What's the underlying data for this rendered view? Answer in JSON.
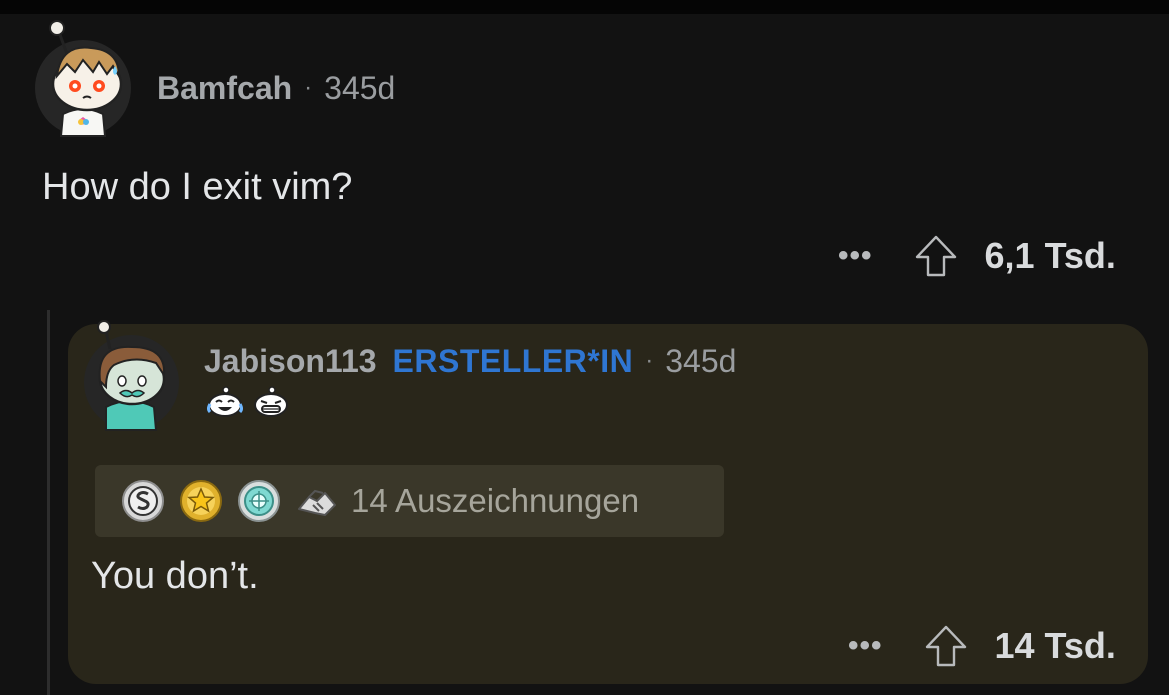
{
  "comment": {
    "author": "Bamfcah",
    "age": "345d",
    "body": "How do I exit vim?",
    "score": "6,1 Tsd.",
    "avatar_icon": "snoo-avatar-icon",
    "more_icon": "more-options-icon",
    "upvote_icon": "upvote-arrow-icon"
  },
  "reply": {
    "author": "Jabison113",
    "op_badge": "ERSTELLER*IN",
    "age": "345d",
    "body": "You don’t.",
    "score": "14 Tsd.",
    "emotes": [
      "laughing-snoo-emote",
      "grinning-snoo-emote"
    ],
    "awards": {
      "icons": [
        "silver-award-icon",
        "gold-star-award-icon",
        "platinum-award-icon",
        "handshake-award-icon"
      ],
      "label": "14 Auszeichnungen"
    }
  },
  "colors": {
    "background": "#121212",
    "reply_card": "#29261a",
    "awards_bar": "#3a3729",
    "op_badge": "#2f76d2"
  },
  "separator": "·",
  "more_glyph": "•••"
}
